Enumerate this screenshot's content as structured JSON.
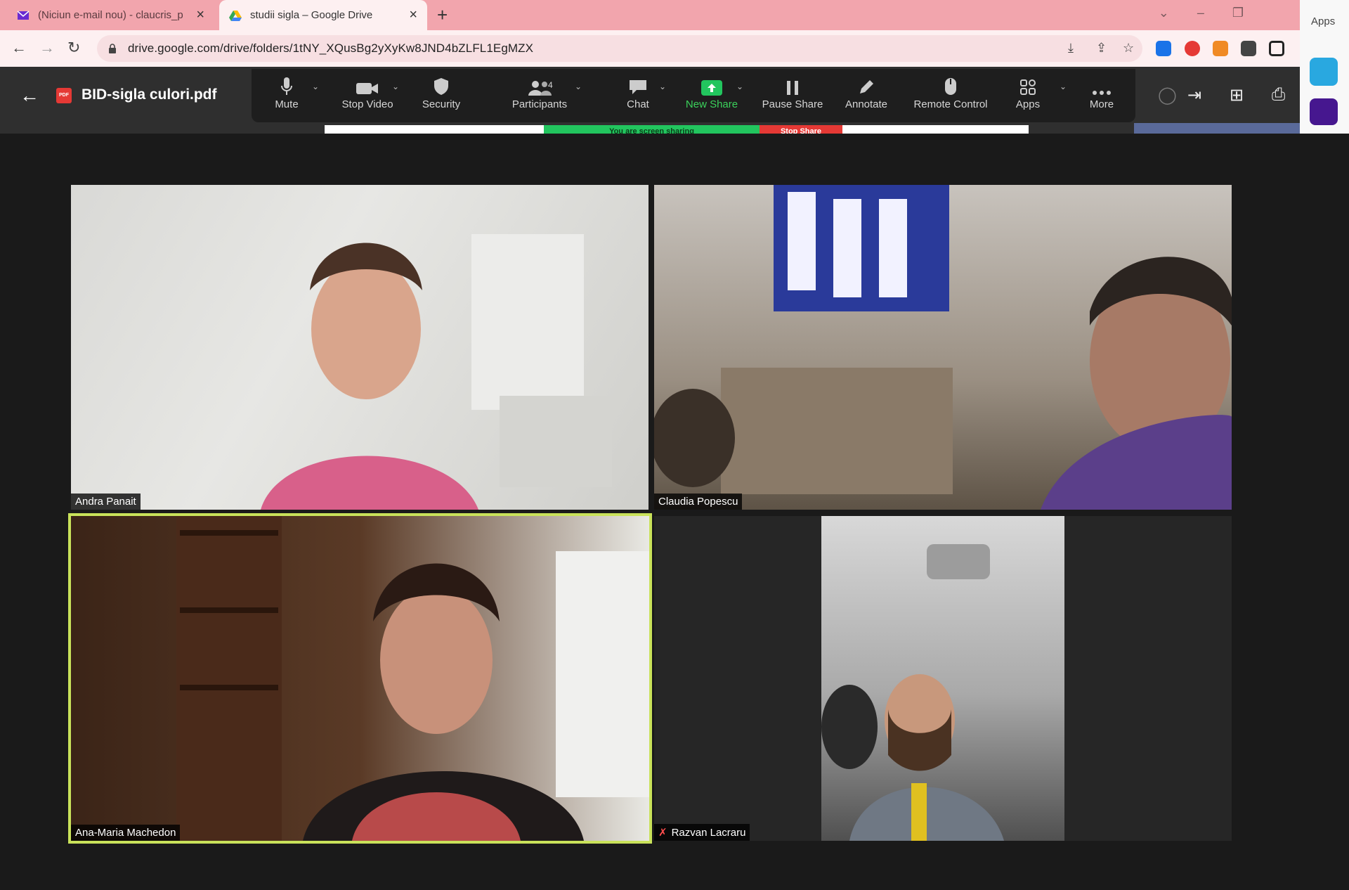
{
  "browser": {
    "tabs": [
      {
        "title": "(Niciun e-mail nou) - claucris_p",
        "active": false
      },
      {
        "title": "studii sigla – Google Drive",
        "active": true
      }
    ],
    "new_tab": "+",
    "url": "drive.google.com/drive/folders/1tNY_XQusBg2yXyKw8JND4bZLFL1EgMZX",
    "side_panel_label": "Apps"
  },
  "pdf_viewer": {
    "badge": "PDF",
    "title": "BID-sigla culori.pdf"
  },
  "zoom_toolbar": {
    "buttons": [
      {
        "label": "Mute"
      },
      {
        "label": "Stop Video"
      },
      {
        "label": "Security"
      },
      {
        "label": "Participants"
      },
      {
        "label": "Chat"
      },
      {
        "label": "New Share"
      },
      {
        "label": "Pause Share"
      },
      {
        "label": "Annotate"
      },
      {
        "label": "Remote Control"
      },
      {
        "label": "Apps"
      },
      {
        "label": "More"
      }
    ],
    "participant_count": "4"
  },
  "share_banner": {
    "sharing_text": "You are screen sharing",
    "stop_label": "Stop Share"
  },
  "participants": [
    {
      "name": "Andra Panait"
    },
    {
      "name": "Claudia Popescu"
    },
    {
      "name": "Ana-Maria Machedon"
    },
    {
      "name": "Razvan Lacraru"
    }
  ],
  "colors": {
    "speaker_border": "#c9e25a",
    "share_green": "#22c55e",
    "stop_red": "#e53935",
    "tabstrip": "#f2a5ad"
  }
}
